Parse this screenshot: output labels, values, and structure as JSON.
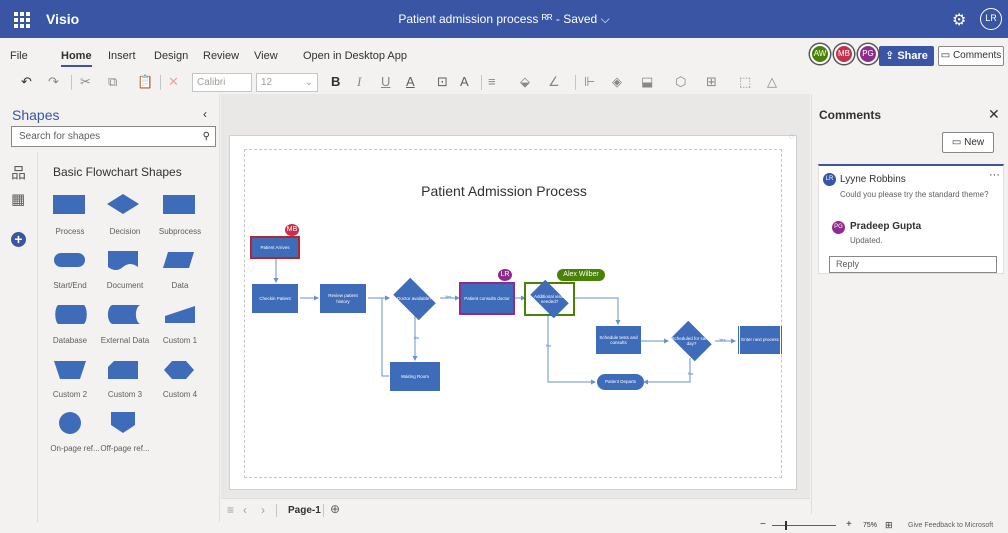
{
  "titlebar": {
    "app_name": "Visio",
    "doc_title": "Patient admission process ᴿᴿ - Saved  ⌵",
    "user_initials": "LR"
  },
  "menu": {
    "tabs": [
      "File",
      "Home",
      "Insert",
      "Design",
      "Review",
      "View",
      "Open in Desktop App"
    ],
    "active_tab": "Home",
    "share_label": "Share",
    "comments_label": "Comments",
    "collaborators": [
      {
        "initials": "AW",
        "color": "#498205"
      },
      {
        "initials": "MB",
        "color": "#c4314b"
      },
      {
        "initials": "PG",
        "color": "#8e2c8e"
      }
    ]
  },
  "toolbar": {
    "font_name": "Calibri",
    "font_size": "12"
  },
  "shapes_panel": {
    "title": "Shapes",
    "search_placeholder": "Search for shapes",
    "category": "Basic Flowchart Shapes",
    "stencils": [
      "Process",
      "Decision",
      "Subprocess",
      "Start/End",
      "Document",
      "Data",
      "Database",
      "External Data",
      "Custom 1",
      "Custom 2",
      "Custom 3",
      "Custom 4",
      "On-page ref...",
      "Off-page ref..."
    ]
  },
  "diagram": {
    "title": "Patient Admission Process",
    "nodes": {
      "patient_arrives": "Patient Arrives",
      "checkin": "Checkin Patient",
      "review_history": "Review patient history",
      "doctor_available": "Doctor available?",
      "waiting_room": "Waiting Room",
      "patient_consults": "Patient consults doctor",
      "additional_visits": "Additional visits needed?",
      "schedule_tests": "Schedule tests and consults",
      "scheduled_same_day": "Scheduled for same day?",
      "enter_next": "Enter next process",
      "patient_departs": "Patient Departs"
    },
    "edge_labels": {
      "yes": "Yes",
      "no": "No"
    },
    "flags": {
      "mb": "MB",
      "lr": "LR",
      "alex": "Alex Wilber"
    },
    "colors": {
      "shape": "#3e6cb9",
      "connector": "#6b8fcf"
    }
  },
  "comments_panel": {
    "title": "Comments",
    "new_label": "New",
    "thread": {
      "author": "Lyyne Robbins",
      "author_initials": "LR",
      "text": "Could you please try the standard theme?",
      "reply_author": "Pradeep Gupta",
      "reply_initials": "PG",
      "reply_text": "Updated.",
      "reply_placeholder": "Reply"
    }
  },
  "page_tabs": {
    "current": "Page-1"
  },
  "status": {
    "zoom": "75%",
    "feedback": "Give Feedback to Microsoft"
  }
}
